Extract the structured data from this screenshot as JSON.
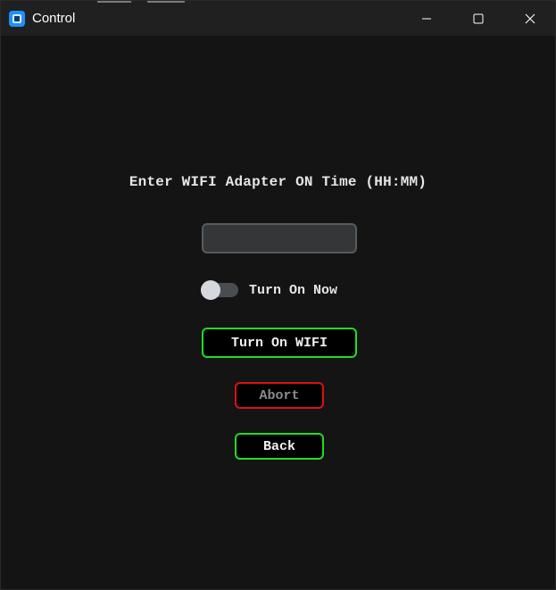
{
  "window": {
    "title": "Control",
    "icon": "app-icon",
    "controls": {
      "minimize_icon": "minimize-icon",
      "maximize_icon": "maximize-icon",
      "close_icon": "close-icon"
    }
  },
  "form": {
    "prompt": "Enter WIFI Adapter ON Time (HH:MM)",
    "time_input": {
      "value": "",
      "placeholder": ""
    },
    "switch": {
      "label": "Turn On Now",
      "on": false
    },
    "buttons": {
      "turn_on_wifi": "Turn On WIFI",
      "abort": "Abort",
      "back": "Back"
    }
  },
  "colors": {
    "background": "#141414",
    "titlebar": "#202020",
    "accent_green": "#22dd22",
    "accent_red": "#dd1111",
    "disabled_text": "#8a8a8a"
  }
}
